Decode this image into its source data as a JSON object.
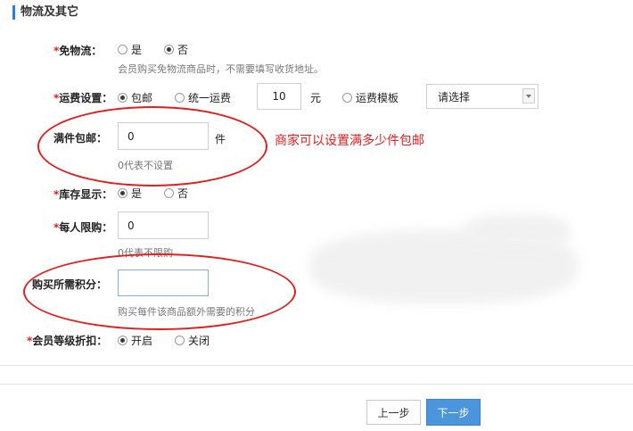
{
  "section": {
    "title": "物流及其它"
  },
  "free_shipping": {
    "label": "免物流：",
    "options": [
      "是",
      "否"
    ],
    "selected": 1,
    "hint": "会员购买免物流商品时，不需要填写收货地址。"
  },
  "shipping_settings": {
    "label": "运费设置：",
    "opt_free": "包邮",
    "opt_flat": "统一运费",
    "flat_value": "10",
    "flat_unit": "元",
    "opt_template": "运费模板",
    "template_select": "请选择",
    "selected": 0
  },
  "full_pieces": {
    "label": "满件包邮：",
    "value": "0",
    "unit": "件",
    "hint": "0代表不设置",
    "annotation": "商家可以设置满多少件包邮"
  },
  "stock_display": {
    "label": "库存显示：",
    "options": [
      "是",
      "否"
    ],
    "selected": 0
  },
  "purchase_limit": {
    "label": "每人限购：",
    "value": "0",
    "hint": "0代表不限购"
  },
  "points_required": {
    "label": "购买所需积分：",
    "value": "",
    "hint": "购买每件该商品额外需要的积分"
  },
  "member_discount": {
    "label": "会员等级折扣：",
    "options": [
      "开启",
      "关闭"
    ],
    "selected": 0
  },
  "required_mark": "*",
  "buttons": {
    "prev": "上一步",
    "next": "下一步"
  },
  "colors": {
    "accent": "#2a7fd4",
    "annotation": "#e41e1e",
    "primary_button": "#4a95db"
  }
}
